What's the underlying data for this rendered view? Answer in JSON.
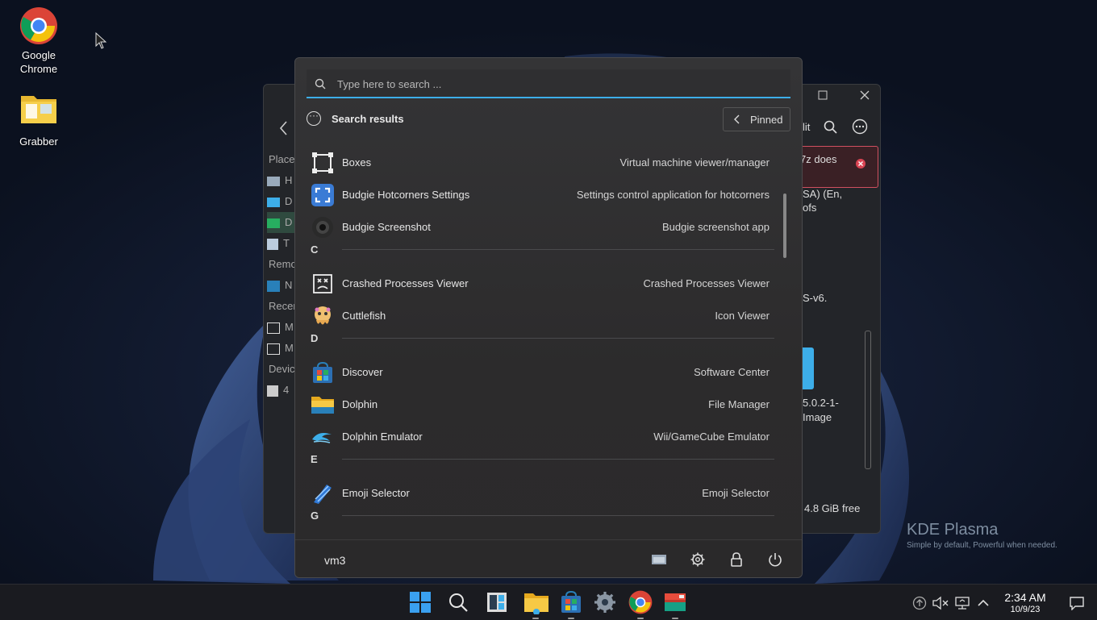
{
  "desktop": {
    "icons": [
      {
        "label": "Google\nChrome",
        "icon": "chrome-icon"
      },
      {
        "label": "Grabber",
        "icon": "folder-icon"
      }
    ]
  },
  "background_window": {
    "sidebar_labels": [
      "Place",
      "H",
      "D",
      "D",
      "T",
      "Remo",
      "N",
      "Recen",
      "M",
      "M",
      "Devic",
      "4"
    ],
    "error_text": "7z does",
    "fragments": [
      "SA) (En,",
      "ofs",
      "S-v6.",
      "5.0.2-1-",
      "Image",
      "lit"
    ],
    "free_space": "4.8 GiB free"
  },
  "kde_logo": {
    "title": "KDE Plasma",
    "tagline": "Simple by default, Powerful when  needed."
  },
  "launcher": {
    "search_placeholder": "Type here to search ...",
    "header_title": "Search results",
    "pinned_label": "Pinned",
    "items": [
      {
        "type": "app",
        "name": "Boxes",
        "desc": "Virtual machine viewer/manager",
        "icon": "boxes-icon"
      },
      {
        "type": "app",
        "name": "Budgie Hotcorners Settings",
        "desc": "Settings control application for hotcorners",
        "icon": "hotcorners-icon"
      },
      {
        "type": "app",
        "name": "Budgie Screenshot",
        "desc": "Budgie screenshot app",
        "icon": "camera-icon"
      },
      {
        "type": "section",
        "letter": "C"
      },
      {
        "type": "app",
        "name": "Crashed Processes Viewer",
        "desc": "Crashed Processes Viewer",
        "icon": "crash-icon"
      },
      {
        "type": "app",
        "name": "Cuttlefish",
        "desc": "Icon Viewer",
        "icon": "cuttlefish-icon"
      },
      {
        "type": "section",
        "letter": "D"
      },
      {
        "type": "app",
        "name": "Discover",
        "desc": "Software Center",
        "icon": "discover-icon"
      },
      {
        "type": "app",
        "name": "Dolphin",
        "desc": "File Manager",
        "icon": "dolphin-folder-icon"
      },
      {
        "type": "app",
        "name": "Dolphin Emulator",
        "desc": "Wii/GameCube Emulator",
        "icon": "dolphin-emulator-icon"
      },
      {
        "type": "section",
        "letter": "E"
      },
      {
        "type": "app",
        "name": "Emoji Selector",
        "desc": "Emoji Selector",
        "icon": "emoji-selector-icon"
      },
      {
        "type": "section",
        "letter": "G"
      }
    ],
    "footer": {
      "username": "vm3"
    }
  },
  "taskbar": {
    "clock_time": "2:34 AM",
    "clock_date": "10/9/23"
  },
  "colors": {
    "accent": "#3daee9",
    "launcher_bg": "#2d2c2d",
    "taskbar_bg": "#1a1b20"
  }
}
